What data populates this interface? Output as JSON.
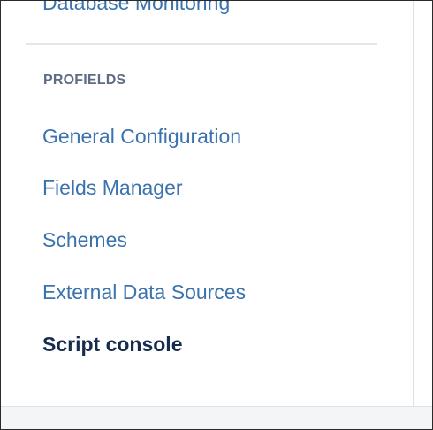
{
  "sidebar": {
    "previous_item": {
      "label": "Database Monitoring"
    },
    "section": {
      "heading": "PROFIELDS",
      "items": [
        {
          "label": "General Configuration"
        },
        {
          "label": "Fields Manager"
        },
        {
          "label": "Schemes"
        },
        {
          "label": "External Data Sources"
        },
        {
          "label": "Script console",
          "active": true
        }
      ]
    }
  },
  "colors": {
    "link": "#3b73af",
    "active_text": "#172b4d",
    "heading_text": "#5e6c84",
    "divider": "#e6e6e6",
    "footer_bg": "#f4f5f7"
  }
}
